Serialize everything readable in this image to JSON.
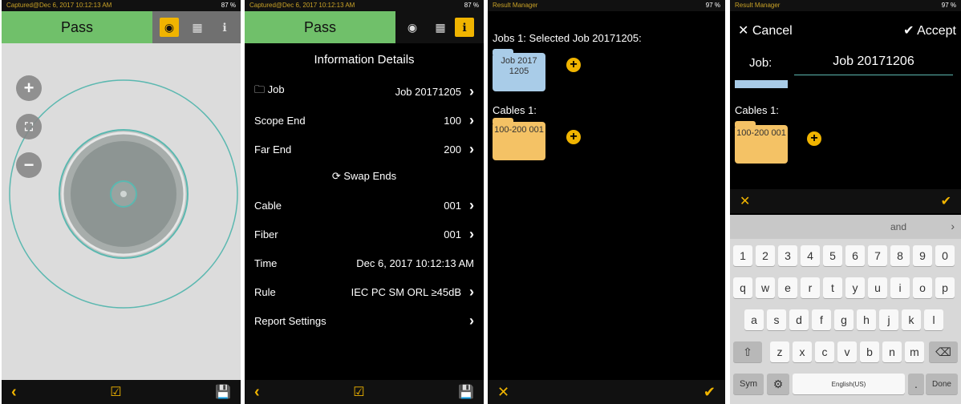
{
  "screen1": {
    "status_left": "Captured@Dec 6, 2017 10:12:13 AM",
    "status_right": "87 %",
    "pass_label": "Pass",
    "icons": [
      "fiber-view-icon",
      "grid-icon",
      "info-icon"
    ],
    "zoom": [
      "zoom-in-icon",
      "fit-icon",
      "zoom-out-icon"
    ],
    "bottom": [
      "back-icon",
      "check-icon",
      "save-icon"
    ]
  },
  "screen2": {
    "status_left": "Captured@Dec 6, 2017 10:12:13 AM",
    "status_right": "87 %",
    "pass_label": "Pass",
    "title": "Information Details",
    "rows": [
      {
        "label": "Job",
        "value": "Job 20171205",
        "chev": true,
        "icon": true
      },
      {
        "label": "Scope End",
        "value": "100",
        "chev": true
      },
      {
        "label": "Far End",
        "value": "200",
        "chev": true
      }
    ],
    "swap_label": "Swap Ends",
    "rows2": [
      {
        "label": "Cable",
        "value": "001",
        "chev": true
      },
      {
        "label": "Fiber",
        "value": "001",
        "chev": true
      },
      {
        "label": "Time",
        "value": "Dec 6, 2017 10:12:13 AM",
        "chev": false
      },
      {
        "label": "Rule",
        "value": "IEC PC SM ORL ≥45dB",
        "chev": true
      },
      {
        "label": "Report Settings",
        "value": "",
        "chev": true
      }
    ]
  },
  "screen3": {
    "status_left": "Result Manager",
    "status_right": "97 %",
    "jobs_header": "Jobs 1: Selected Job 20171205:",
    "job_folder": "Job 2017 1205",
    "cables_header": "Cables 1:",
    "cable_folder": "100-200 001"
  },
  "screen4": {
    "status_left": "Result Manager",
    "status_right": "97 %",
    "cancel": "Cancel",
    "accept": "Accept",
    "job_label": "Job:",
    "job_value": "Job 20171206",
    "cables_header": "Cables 1:",
    "cable_folder": "100-200 001",
    "suggestion": "and",
    "keys_num": [
      "1",
      "2",
      "3",
      "4",
      "5",
      "6",
      "7",
      "8",
      "9",
      "0"
    ],
    "keys_r1": [
      "q",
      "w",
      "e",
      "r",
      "t",
      "y",
      "u",
      "i",
      "o",
      "p"
    ],
    "keys_r2": [
      "a",
      "s",
      "d",
      "f",
      "g",
      "h",
      "j",
      "k",
      "l"
    ],
    "keys_r3": [
      "z",
      "x",
      "c",
      "v",
      "b",
      "n",
      "m"
    ],
    "sym": "Sym",
    "space": "English(US)",
    "done": "Done"
  },
  "colors": {
    "accent": "#f0b400",
    "pass": "#70c06a",
    "fiber": "#5bb8b0"
  }
}
